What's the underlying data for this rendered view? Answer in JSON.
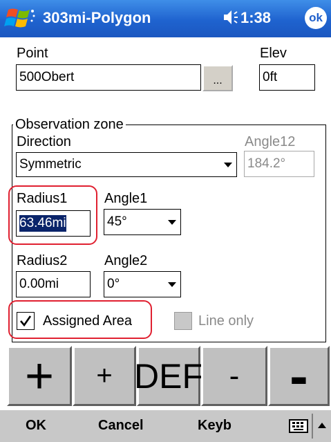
{
  "titlebar": {
    "title": "303mi-Polygon",
    "speaker_icon": "speaker-icon",
    "time": "1:38",
    "ok_label": "ok",
    "accent": "#1f63cf"
  },
  "point": {
    "label": "Point",
    "value": "500Obert",
    "browse_label": "..."
  },
  "elev": {
    "label": "Elev",
    "value": "0ft"
  },
  "zone": {
    "legend": "Observation zone",
    "direction_label": "Direction",
    "direction_value": "Symmetric",
    "angle12_label": "Angle12",
    "angle12_value": "184.2°",
    "radius1_label": "Radius1",
    "radius1_value": "63.46mi",
    "angle1_label": "Angle1",
    "angle1_value": "45°",
    "radius2_label": "Radius2",
    "radius2_value": "0.00mi",
    "angle2_label": "Angle2",
    "angle2_value": "0°",
    "assigned_label": "Assigned Area",
    "assigned_checked": true,
    "line_only_label": "Line only",
    "line_only_checked": false,
    "highlight_color": "#e02030"
  },
  "buttons": {
    "big_plus": "+",
    "plus": "+",
    "def": "DEF",
    "minus": "-",
    "big_minus": "-"
  },
  "menubar": {
    "ok": "OK",
    "cancel": "Cancel",
    "keyb": "Keyb",
    "keyboard_icon": "keyboard-icon",
    "up_arrow_icon": "up-arrow-icon"
  }
}
